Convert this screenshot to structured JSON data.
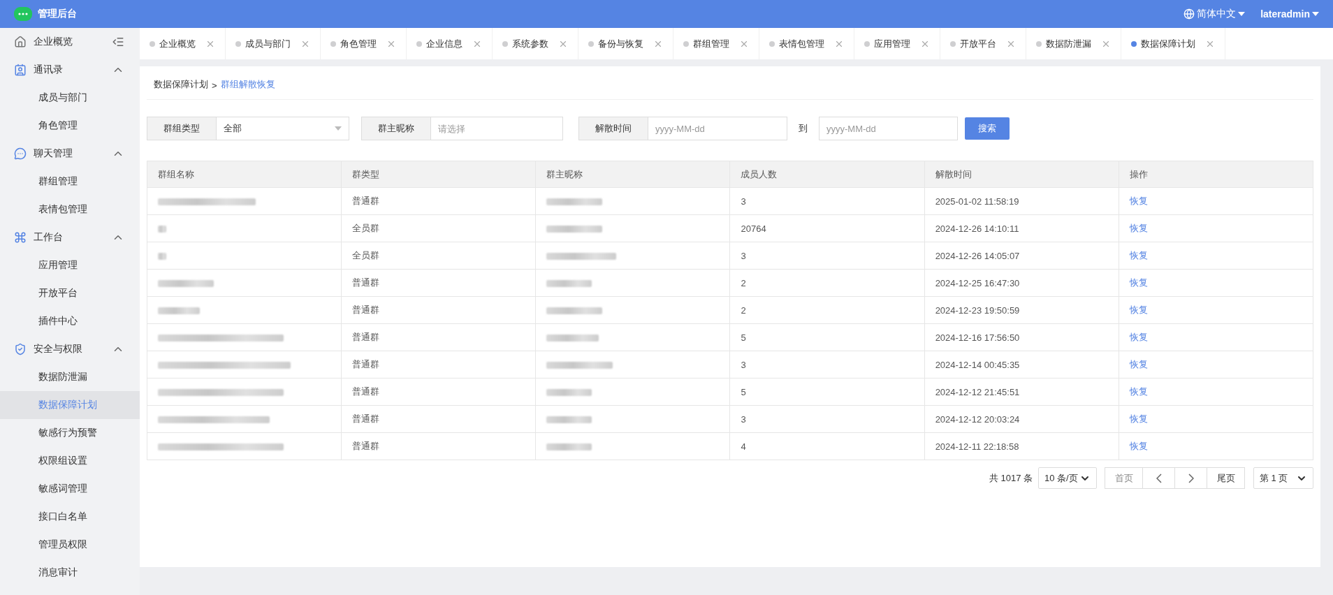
{
  "header": {
    "title": "管理后台",
    "language": "简体中文",
    "user": "lateradmin"
  },
  "sidebar": {
    "items": [
      {
        "kind": "link",
        "label": "企业概览",
        "selected": false
      },
      {
        "kind": "group",
        "label": "通讯录",
        "expanded": true,
        "children": [
          {
            "label": "成员与部门",
            "selected": false
          },
          {
            "label": "角色管理",
            "selected": false
          }
        ]
      },
      {
        "kind": "group",
        "label": "聊天管理",
        "expanded": true,
        "children": [
          {
            "label": "群组管理",
            "selected": false
          },
          {
            "label": "表情包管理",
            "selected": false
          }
        ]
      },
      {
        "kind": "group",
        "label": "工作台",
        "expanded": true,
        "children": [
          {
            "label": "应用管理",
            "selected": false
          },
          {
            "label": "开放平台",
            "selected": false
          },
          {
            "label": "插件中心",
            "selected": false
          }
        ]
      },
      {
        "kind": "group",
        "label": "安全与权限",
        "expanded": true,
        "children": [
          {
            "label": "数据防泄漏",
            "selected": false
          },
          {
            "label": "数据保障计划",
            "selected": true
          },
          {
            "label": "敏感行为预警",
            "selected": false
          },
          {
            "label": "权限组设置",
            "selected": false
          },
          {
            "label": "敏感词管理",
            "selected": false
          },
          {
            "label": "接口白名单",
            "selected": false
          },
          {
            "label": "管理员权限",
            "selected": false
          },
          {
            "label": "消息审计",
            "selected": false
          }
        ]
      }
    ]
  },
  "tabs": [
    {
      "label": "企业概览",
      "selected": false
    },
    {
      "label": "成员与部门",
      "selected": false
    },
    {
      "label": "角色管理",
      "selected": false
    },
    {
      "label": "企业信息",
      "selected": false
    },
    {
      "label": "系统参数",
      "selected": false
    },
    {
      "label": "备份与恢复",
      "selected": false
    },
    {
      "label": "群组管理",
      "selected": false
    },
    {
      "label": "表情包管理",
      "selected": false
    },
    {
      "label": "应用管理",
      "selected": false
    },
    {
      "label": "开放平台",
      "selected": false
    },
    {
      "label": "数据防泄漏",
      "selected": false
    },
    {
      "label": "数据保障计划",
      "selected": true
    }
  ],
  "breadcrumb": {
    "parent": "数据保障计划",
    "separator": ">",
    "current": "群组解散恢复"
  },
  "filters": {
    "group_type": {
      "label": "群组类型",
      "value": "全部"
    },
    "owner": {
      "label": "群主昵称",
      "placeholder": "请选择"
    },
    "time": {
      "label": "解散时间",
      "from_placeholder": "yyyy-MM-dd",
      "to_label": "到",
      "to_placeholder": "yyyy-MM-dd"
    },
    "search_button": "搜索"
  },
  "table": {
    "columns": [
      "群组名称",
      "群类型",
      "群主昵称",
      "成员人数",
      "解散时间",
      "操作"
    ],
    "rows": [
      {
        "type": "普通群",
        "members": "3",
        "time": "2025-01-02 11:58:19",
        "action": "恢复"
      },
      {
        "type": "全员群",
        "members": "20764",
        "time": "2024-12-26 14:10:11",
        "action": "恢复"
      },
      {
        "type": "全员群",
        "members": "3",
        "time": "2024-12-26 14:05:07",
        "action": "恢复"
      },
      {
        "type": "普通群",
        "members": "2",
        "time": "2024-12-25 16:47:30",
        "action": "恢复"
      },
      {
        "type": "普通群",
        "members": "2",
        "time": "2024-12-23 19:50:59",
        "action": "恢复"
      },
      {
        "type": "普通群",
        "members": "5",
        "time": "2024-12-16 17:56:50",
        "action": "恢复"
      },
      {
        "type": "普通群",
        "members": "3",
        "time": "2024-12-14 00:45:35",
        "action": "恢复"
      },
      {
        "type": "普通群",
        "members": "5",
        "time": "2024-12-12 21:45:51",
        "action": "恢复"
      },
      {
        "type": "普通群",
        "members": "3",
        "time": "2024-12-12 20:03:24",
        "action": "恢复"
      },
      {
        "type": "普通群",
        "members": "4",
        "time": "2024-12-11 22:18:58",
        "action": "恢复"
      }
    ]
  },
  "pagination": {
    "total": "共 1017 条",
    "page_size": "10 条/页",
    "first": "首页",
    "last": "尾页",
    "page": "第 1 页"
  }
}
